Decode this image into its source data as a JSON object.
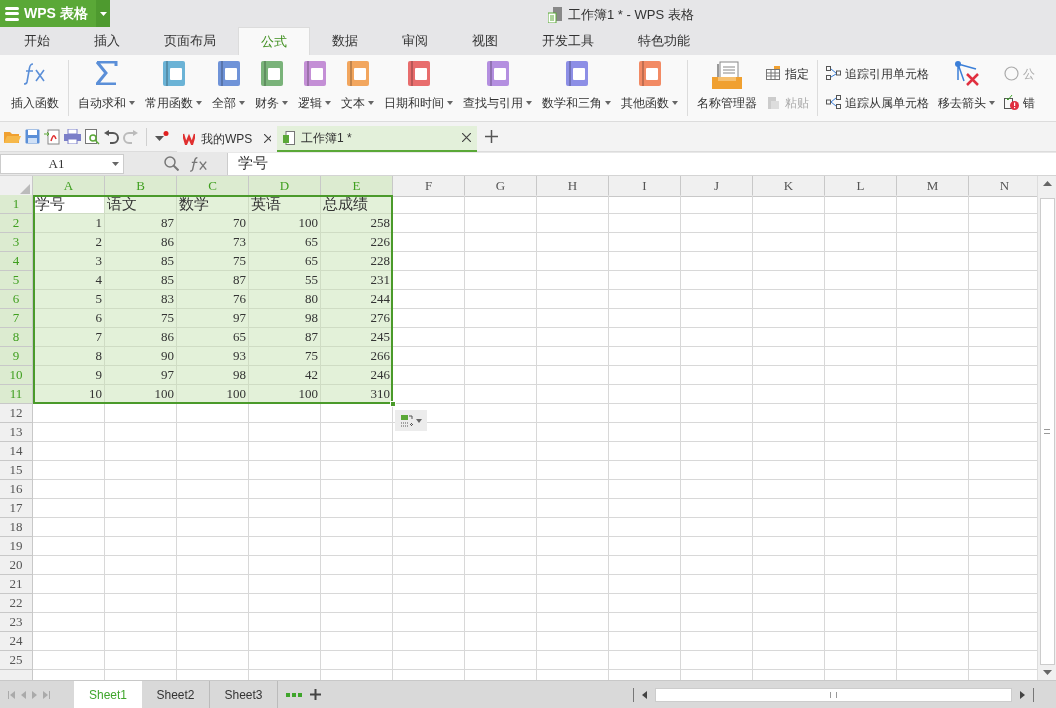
{
  "app_button": {
    "label": "WPS 表格"
  },
  "window": {
    "title": "工作簿1 * - WPS 表格"
  },
  "tabs": [
    {
      "label": "开始",
      "selected": false
    },
    {
      "label": "插入",
      "selected": false
    },
    {
      "label": "页面布局",
      "selected": false
    },
    {
      "label": "公式",
      "selected": true
    },
    {
      "label": "数据",
      "selected": false
    },
    {
      "label": "审阅",
      "selected": false
    },
    {
      "label": "视图",
      "selected": false
    },
    {
      "label": "开发工具",
      "selected": false
    },
    {
      "label": "特色功能",
      "selected": false
    }
  ],
  "ribbon": {
    "items": [
      {
        "kind": "fx",
        "label": "插入函数",
        "dropdown": false
      },
      {
        "kind": "separator"
      },
      {
        "kind": "sigma",
        "label": "自动求和",
        "dropdown": true
      },
      {
        "kind": "book",
        "label": "常用函数",
        "dropdown": true,
        "color": "#6bb3d6"
      },
      {
        "kind": "book",
        "label": "全部",
        "dropdown": true,
        "color": "#6f93d8"
      },
      {
        "kind": "book",
        "label": "财务",
        "dropdown": true,
        "color": "#7ab37a"
      },
      {
        "kind": "book",
        "label": "逻辑",
        "dropdown": true,
        "color": "#c48fd6"
      },
      {
        "kind": "book",
        "label": "文本",
        "dropdown": true,
        "color": "#f2a65e"
      },
      {
        "kind": "book",
        "label": "日期和时间",
        "dropdown": true,
        "color": "#e86d6d"
      },
      {
        "kind": "book",
        "label": "查找与引用",
        "dropdown": true,
        "color": "#b48fe0"
      },
      {
        "kind": "book",
        "label": "数学和三角",
        "dropdown": true,
        "color": "#8d8fe6"
      },
      {
        "kind": "book",
        "label": "其他函数",
        "dropdown": true,
        "color": "#f28a64"
      },
      {
        "kind": "separator"
      },
      {
        "kind": "folder",
        "label": "名称管理器",
        "dropdown": false
      },
      {
        "kind": "stack",
        "children": [
          {
            "label": "指定",
            "disabled": false
          },
          {
            "label": "粘贴",
            "disabled": true
          }
        ]
      },
      {
        "kind": "separator"
      },
      {
        "kind": "stack",
        "children": [
          {
            "label": "追踪引用单元格",
            "disabled": false
          },
          {
            "label": "追踪从属单元格",
            "disabled": false
          }
        ]
      },
      {
        "kind": "arrows",
        "label": "移去箭头",
        "dropdown": true
      },
      {
        "kind": "stack",
        "children": [
          {
            "label": "公",
            "disabled": true
          },
          {
            "label": "错",
            "disabled": false
          }
        ]
      }
    ]
  },
  "doc_tabs": [
    {
      "label": "我的WPS",
      "selected": false
    },
    {
      "label": "工作簿1 *",
      "selected": true
    }
  ],
  "formula_bar": {
    "name_box": "A1",
    "formula": "学号"
  },
  "sheet": {
    "columns": [
      {
        "label": "A",
        "selected": true
      },
      {
        "label": "B",
        "selected": true
      },
      {
        "label": "C",
        "selected": true
      },
      {
        "label": "D",
        "selected": true
      },
      {
        "label": "E",
        "selected": true
      },
      {
        "label": "F",
        "selected": false
      },
      {
        "label": "G",
        "selected": false
      },
      {
        "label": "H",
        "selected": false
      },
      {
        "label": "I",
        "selected": false
      },
      {
        "label": "J",
        "selected": false
      },
      {
        "label": "K",
        "selected": false
      },
      {
        "label": "L",
        "selected": false
      },
      {
        "label": "M",
        "selected": false
      },
      {
        "label": "N",
        "selected": false
      }
    ],
    "rows": [
      {
        "label": "1",
        "selected": true,
        "header": true,
        "cells": [
          "学号",
          "语文",
          "数学",
          "英语",
          "总成绩"
        ]
      },
      {
        "label": "2",
        "selected": true,
        "header": false,
        "cells": [
          "1",
          "87",
          "70",
          "100",
          "258"
        ]
      },
      {
        "label": "3",
        "selected": true,
        "header": false,
        "cells": [
          "2",
          "86",
          "73",
          "65",
          "226"
        ]
      },
      {
        "label": "4",
        "selected": true,
        "header": false,
        "cells": [
          "3",
          "85",
          "75",
          "65",
          "228"
        ]
      },
      {
        "label": "5",
        "selected": true,
        "header": false,
        "cells": [
          "4",
          "85",
          "87",
          "55",
          "231"
        ]
      },
      {
        "label": "6",
        "selected": true,
        "header": false,
        "cells": [
          "5",
          "83",
          "76",
          "80",
          "244"
        ]
      },
      {
        "label": "7",
        "selected": true,
        "header": false,
        "cells": [
          "6",
          "75",
          "97",
          "98",
          "276"
        ]
      },
      {
        "label": "8",
        "selected": true,
        "header": false,
        "cells": [
          "7",
          "86",
          "65",
          "87",
          "245"
        ]
      },
      {
        "label": "9",
        "selected": true,
        "header": false,
        "cells": [
          "8",
          "90",
          "93",
          "75",
          "266"
        ]
      },
      {
        "label": "10",
        "selected": true,
        "header": false,
        "cells": [
          "9",
          "97",
          "98",
          "42",
          "246"
        ]
      },
      {
        "label": "11",
        "selected": true,
        "header": false,
        "cells": [
          "10",
          "100",
          "100",
          "100",
          "310"
        ]
      },
      {
        "label": "12",
        "selected": false,
        "cells": []
      },
      {
        "label": "13",
        "selected": false,
        "cells": []
      },
      {
        "label": "14",
        "selected": false,
        "cells": []
      },
      {
        "label": "15",
        "selected": false,
        "cells": []
      },
      {
        "label": "16",
        "selected": false,
        "cells": []
      },
      {
        "label": "17",
        "selected": false,
        "cells": []
      },
      {
        "label": "18",
        "selected": false,
        "cells": []
      },
      {
        "label": "19",
        "selected": false,
        "cells": []
      },
      {
        "label": "20",
        "selected": false,
        "cells": []
      },
      {
        "label": "21",
        "selected": false,
        "cells": []
      },
      {
        "label": "22",
        "selected": false,
        "cells": []
      },
      {
        "label": "23",
        "selected": false,
        "cells": []
      },
      {
        "label": "24",
        "selected": false,
        "cells": []
      },
      {
        "label": "25",
        "selected": false,
        "cells": []
      }
    ]
  },
  "sheet_tabs": [
    {
      "label": "Sheet1",
      "selected": true
    },
    {
      "label": "Sheet2",
      "selected": false
    },
    {
      "label": "Sheet3",
      "selected": false
    }
  ]
}
